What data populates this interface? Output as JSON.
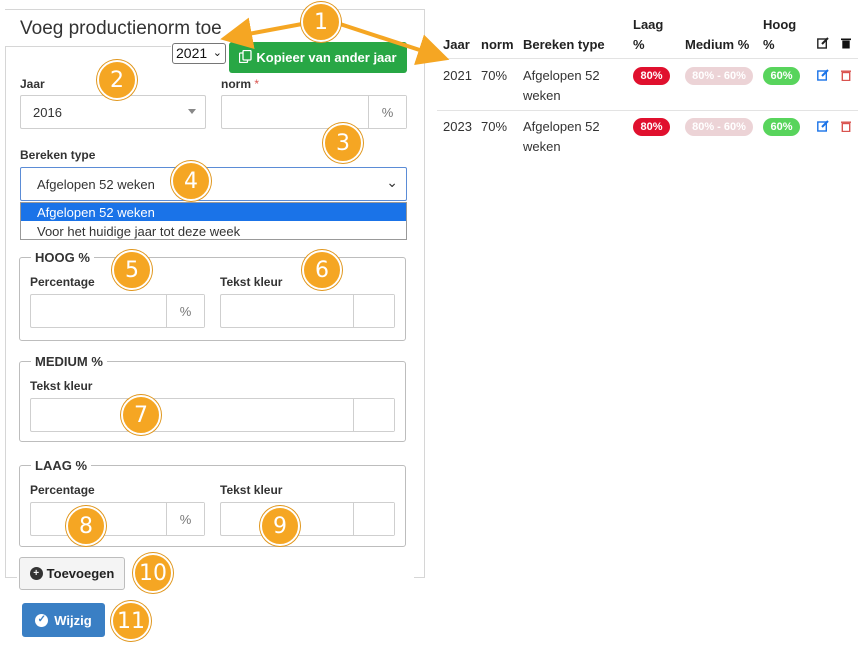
{
  "form": {
    "title": "Voeg productienorm toe",
    "year_selector": "2021",
    "copy_button": "Kopieer van ander jaar",
    "jaar_label": "Jaar",
    "jaar_value": "2016",
    "norm_label": "norm",
    "norm_required": "*",
    "norm_unit": "%",
    "bereken_label": "Bereken type",
    "bereken_value": "Afgelopen 52 weken",
    "bereken_options": [
      "Afgelopen 52 weken",
      "Voor het huidige jaar tot deze week"
    ],
    "hoog": {
      "legend": "HOOG %",
      "percentage_label": "Percentage",
      "percentage_unit": "%",
      "color_label": "Tekst kleur"
    },
    "medium": {
      "legend": "MEDIUM %",
      "color_label": "Tekst kleur"
    },
    "laag": {
      "legend": "LAAG %",
      "percentage_label": "Percentage",
      "percentage_unit": "%",
      "color_label": "Tekst kleur"
    },
    "add_button": "Toevoegen",
    "edit_button": "Wijzig"
  },
  "table": {
    "headers": {
      "jaar": "Jaar",
      "norm": "norm",
      "bereken": "Bereken type",
      "laag_1": "Laag",
      "laag_2": "%",
      "medium": "Medium %",
      "hoog_1": "Hoog",
      "hoog_2": "%"
    },
    "rows": [
      {
        "jaar": "2021",
        "norm": "70%",
        "bereken_1": "Afgelopen 52",
        "bereken_2": "weken",
        "laag": "80%",
        "medium": "80% - 60%",
        "hoog": "60%"
      },
      {
        "jaar": "2023",
        "norm": "70%",
        "bereken_1": "Afgelopen 52",
        "bereken_2": "weken",
        "laag": "80%",
        "medium": "80% - 60%",
        "hoog": "60%"
      }
    ]
  },
  "colors": {
    "green_button": "#28a745",
    "blue_button": "#3a7fc4",
    "badge_red": "#e0102e",
    "badge_medium": "#ecd3d6",
    "badge_green": "#58d45c",
    "callout": "#f5a623",
    "edit_icon": "#1a73e8",
    "delete_icon": "#d9534f"
  },
  "icons": {
    "copy": "copy-icon",
    "plus": "plus-circle-icon",
    "check": "check-circle-icon",
    "edit": "edit-icon",
    "delete": "trash-icon"
  },
  "callouts": [
    "1",
    "2",
    "3",
    "4",
    "5",
    "6",
    "7",
    "8",
    "9",
    "10",
    "11"
  ]
}
